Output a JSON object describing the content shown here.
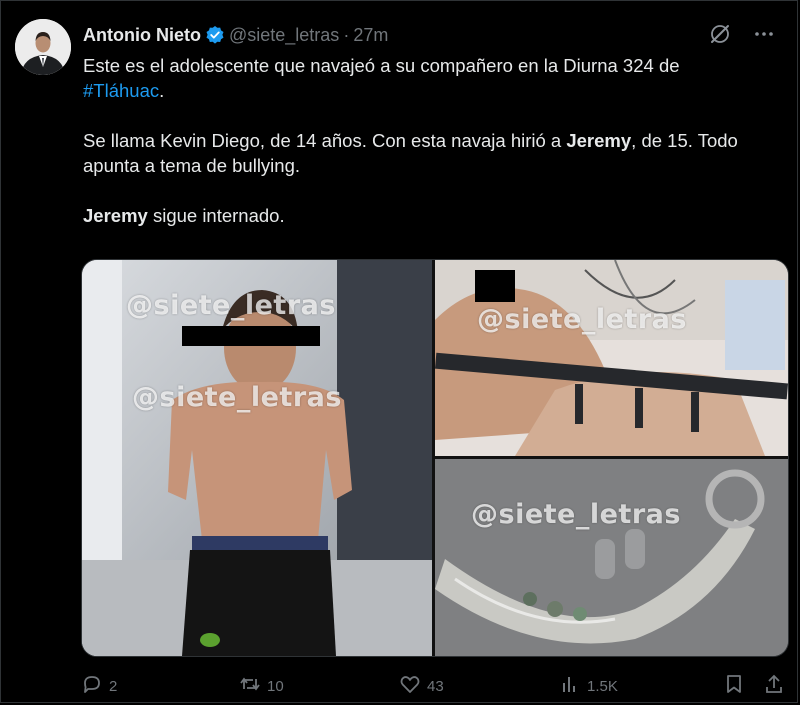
{
  "author": {
    "name": "Antonio Nieto",
    "handle": "@siete_letras",
    "separator": "·",
    "time": "27m"
  },
  "tweet": {
    "line1": "Este es el adolescente que navajeó a su compañero en la Diurna 324 de",
    "hashtag": "#Tláhuac",
    "hashtag_end": ".",
    "p2_start": "Se llama Kevin Diego, de 14 años. Con esta navaja hirió a ",
    "p2_bold": "Jeremy",
    "p2_end": ", de 15. Todo apunta a tema de bullying.",
    "p3_bold": "Jeremy",
    "p3_end": " sigue internado."
  },
  "media": {
    "watermark": "@siete_letras"
  },
  "actions": {
    "replies": "2",
    "reposts": "10",
    "likes": "43",
    "views": "1.5K"
  },
  "colors": {
    "background": "#000000",
    "text": "#e7e9ea",
    "muted": "#71767b",
    "accent": "#1d9bf0"
  },
  "icons": [
    "verified-badge-icon",
    "grok-icon",
    "more-icon",
    "reply-icon",
    "repost-icon",
    "like-icon",
    "views-icon",
    "bookmark-icon",
    "share-icon"
  ]
}
